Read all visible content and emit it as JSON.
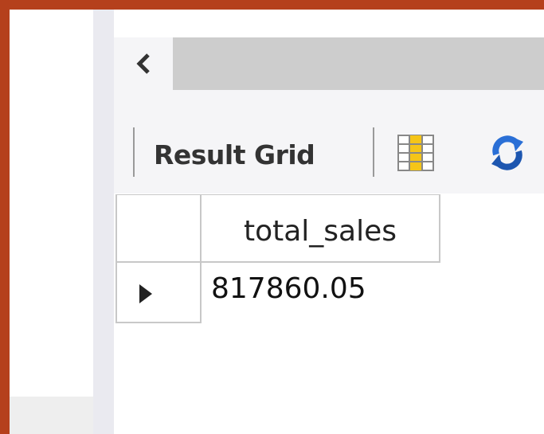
{
  "toolbar": {
    "result_grid_label": "Result Grid"
  },
  "grid": {
    "columns": [
      "total_sales"
    ],
    "rows": [
      [
        "817860.05"
      ]
    ]
  },
  "icons": {
    "scroll_left": "chevron-left-icon",
    "form_editor": "grid-columns-icon",
    "refresh": "refresh-icon",
    "row_pointer": "row-pointer-icon"
  },
  "colors": {
    "border": "#b5401c",
    "grid_icon_fill": "#f5c518",
    "refresh_blue": "#2a6fd6"
  }
}
